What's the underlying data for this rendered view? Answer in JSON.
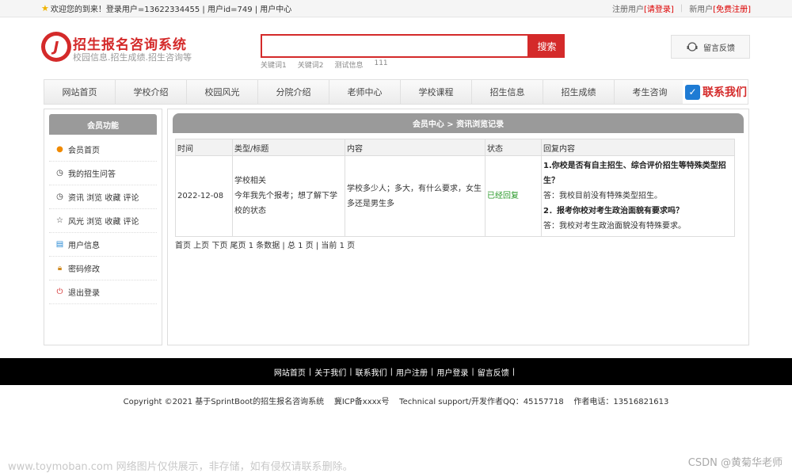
{
  "topbar": {
    "welcome": "欢迎您的到来！登录用户=13622334455 | 用户id=749 | 用户中心",
    "reg_user": "注册用户",
    "login": "[请登录]",
    "new_user": "新用户",
    "free_register": "[免费注册]"
  },
  "brand": {
    "title": "招生报名咨询系统",
    "subtitle": "校园信息.招生成绩.招生咨询等"
  },
  "search": {
    "placeholder": "",
    "button": "搜索",
    "keywords": [
      "关键词1",
      "关键词2",
      "测试信息",
      "111"
    ]
  },
  "feedback": "留言反馈",
  "nav": {
    "items": [
      "网站首页",
      "学校介绍",
      "校园风光",
      "分院介绍",
      "老师中心",
      "学校课程",
      "招生信息",
      "招生成绩",
      "考生咨询"
    ],
    "contact": "联系我们"
  },
  "sidebar": {
    "title": "会员功能",
    "items": [
      {
        "label": "会员首页",
        "icon": "home-icon"
      },
      {
        "label": "我的招生问答",
        "icon": "clock-icon"
      },
      {
        "label": "资讯 浏览 收藏 评论",
        "icon": "clock-icon"
      },
      {
        "label": "风光 浏览 收藏 评论",
        "icon": "star-icon"
      },
      {
        "label": "用户信息",
        "icon": "document-icon"
      },
      {
        "label": "密码修改",
        "icon": "lock-icon"
      },
      {
        "label": "退出登录",
        "icon": "power-icon"
      }
    ]
  },
  "main": {
    "title": "会员中心 > 资讯浏览记录",
    "columns": [
      "时间",
      "类型/标题",
      "内容",
      "状态",
      "回复内容"
    ],
    "row": {
      "time": "2022-12-08",
      "type": "学校相关",
      "title": "今年我先个报考；想了解下学校的状态",
      "content": "学校多少人；多大，有什么要求，女生多还是男生多",
      "status": "已经回复",
      "q1": "1.你校是否有自主招生、综合评价招生等特殊类型招生？",
      "a1": "答：我校目前没有特殊类型招生。",
      "q2": "2．报考你校对考生政治面貌有要求吗？",
      "a2": "答：我校对考生政治面貌没有特殊要求。"
    },
    "pager": "首页 上页 下页 尾页 1 条数据 | 总 1 页 | 当前 1 页"
  },
  "footer": {
    "links": [
      "网站首页",
      "关于我们",
      "联系我们",
      "用户注册",
      "用户登录",
      "留言反馈"
    ],
    "copyright": "Copyright ©2021 基于SprintBoot的招生报名咨询系统    冀ICP备xxxx号    Technical support/开发作者QQ：45157718    作者电话：13516821613"
  },
  "watermark": {
    "left": "www.toymoban.com 网络图片仅供展示，非存储，如有侵权请联系删除。",
    "right": "CSDN @黄菊华老师"
  },
  "colors": {
    "brand_red": "#d42a2a",
    "status_green": "#2a9a2a",
    "footer_bg": "#000000"
  }
}
